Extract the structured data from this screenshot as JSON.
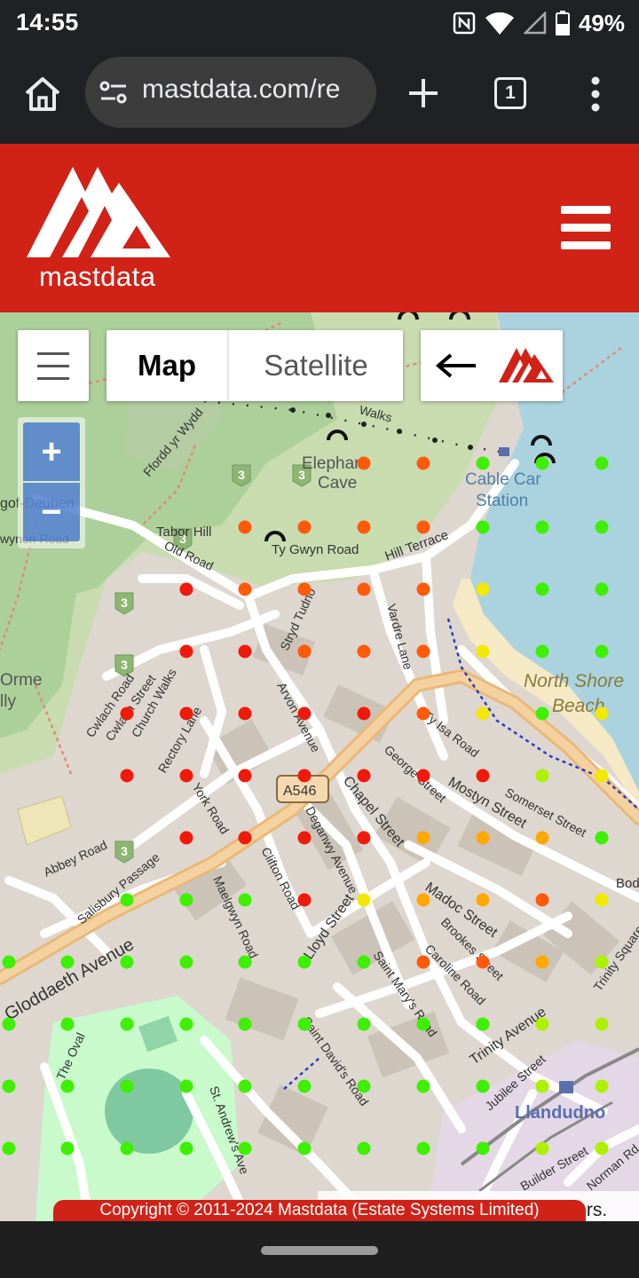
{
  "status": {
    "time": "14:55",
    "battery": "49%"
  },
  "browser": {
    "url": "mastdata.com/re",
    "tab_count": "1"
  },
  "site": {
    "logo_text": "mastdata",
    "brand_color": "#d12218"
  },
  "map_controls": {
    "map_label": "Map",
    "satellite_label": "Satellite",
    "zoom_in": "+",
    "zoom_out": "−"
  },
  "map_labels": [
    {
      "text": "Elephant"
    },
    {
      "text": "Cave"
    },
    {
      "text": "Cable Car"
    },
    {
      "text": "Station"
    },
    {
      "text": "Ty Gwyn Road"
    },
    {
      "text": "Hill Terrace"
    },
    {
      "text": "Ffordd yr Wydd"
    },
    {
      "text": "Tabor Hill"
    },
    {
      "text": "Old Road"
    },
    {
      "text": "Stryd Tudno"
    },
    {
      "text": "Vardre Lane"
    },
    {
      "text": "North Shore"
    },
    {
      "text": "Beach"
    },
    {
      "text": "Cwlach Road"
    },
    {
      "text": "Cwlach Street"
    },
    {
      "text": "Church Walks"
    },
    {
      "text": "Rectory Lane"
    },
    {
      "text": "Arvon Avenue"
    },
    {
      "text": "Ty Isa Road"
    },
    {
      "text": "George Street"
    },
    {
      "text": "Mostyn Street"
    },
    {
      "text": "Somerset Street"
    },
    {
      "text": "Chapel Street"
    },
    {
      "text": "A546"
    },
    {
      "text": "York Road"
    },
    {
      "text": "Deganwy Avenue"
    },
    {
      "text": "Madoc Street"
    },
    {
      "text": "Abbey Road"
    },
    {
      "text": "Salisbury Passage"
    },
    {
      "text": "Clifton Road"
    },
    {
      "text": "Maelgwyn Road"
    },
    {
      "text": "Lloyd Street"
    },
    {
      "text": "Brookes Street"
    },
    {
      "text": "Caroline Road"
    },
    {
      "text": "Gloddaeth Avenue"
    },
    {
      "text": "Saint Mary's Road"
    },
    {
      "text": "Trinity Avenue"
    },
    {
      "text": "Trinity Square"
    },
    {
      "text": "The Oval"
    },
    {
      "text": "Saint David's Road"
    },
    {
      "text": "Jubilee Street"
    },
    {
      "text": "St. Andrew's Ave"
    },
    {
      "text": "Llandudno"
    },
    {
      "text": "Norman Rd"
    },
    {
      "text": "Builder Street"
    },
    {
      "text": "Bod"
    },
    {
      "text": "Orme"
    },
    {
      "text": "lly"
    },
    {
      "text": "gof-Deuben"
    },
    {
      "text": "wynon Road"
    },
    {
      "text": "Walks"
    }
  ],
  "signal_colors": {
    "red": "#f01a0a",
    "orange": "#ff5a0a",
    "amber": "#ffa800",
    "yellow": "#f2e800",
    "lime": "#aef000",
    "green": "#3ef000"
  },
  "attribution": "butors.",
  "copyright": "Copyright © 2011-2024 Mastdata (Estate Systems Limited)"
}
